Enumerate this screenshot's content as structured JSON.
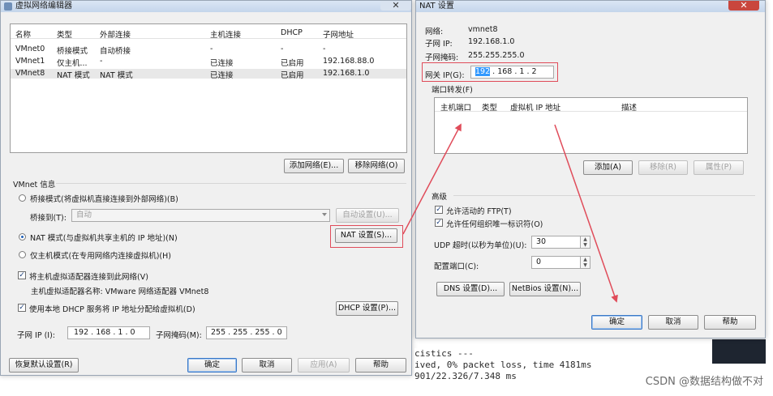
{
  "vne": {
    "title": "虚拟网络编辑器",
    "close": "✕",
    "table": {
      "headers": [
        "名称",
        "类型",
        "外部连接",
        "主机连接",
        "DHCP",
        "子网地址"
      ],
      "rows": [
        [
          "VMnet0",
          "桥接模式",
          "自动桥接",
          "-",
          "-",
          "-"
        ],
        [
          "VMnet1",
          "仅主机...",
          "-",
          "已连接",
          "已启用",
          "192.168.88.0"
        ],
        [
          "VMnet8",
          "NAT 模式",
          "NAT 模式",
          "已连接",
          "已启用",
          "192.168.1.0"
        ]
      ]
    },
    "add_network": "添加网络(E)...",
    "remove_network": "移除网络(O)",
    "vmnet_info": "VMnet 信息",
    "bridge_mode": "桥接模式(将虚拟机直接连接到外部网络)(B)",
    "bridge_to_label": "桥接到(T):",
    "bridge_to_value": "自动",
    "auto_settings": "自动设置(U)...",
    "nat_mode": "NAT 模式(与虚拟机共享主机的 IP 地址)(N)",
    "nat_settings": "NAT 设置(S)...",
    "host_only": "仅主机模式(在专用网络内连接虚拟机)(H)",
    "connect_adapter": "将主机虚拟适配器连接到此网络(V)",
    "adapter_name": "主机虚拟适配器名称: VMware 网络适配器 VMnet8",
    "use_dhcp": "使用本地 DHCP 服务将 IP 地址分配给虚拟机(D)",
    "dhcp_settings": "DHCP 设置(P)...",
    "subnet_ip_label": "子网 IP (I):",
    "subnet_ip": "192 . 168 . 1 . 0",
    "subnet_mask_label": "子网掩码(M):",
    "subnet_mask": "255 . 255 . 255 . 0",
    "restore_defaults": "恢复默认设置(R)",
    "ok": "确定",
    "cancel": "取消",
    "apply": "应用(A)",
    "help": "帮助"
  },
  "nat": {
    "title": "NAT 设置",
    "close": "✕",
    "network_label": "网络:",
    "network_value": "vmnet8",
    "subnet_ip_label": "子网 IP:",
    "subnet_ip_value": "192.168.1.0",
    "subnet_mask_label": "子网掩码:",
    "subnet_mask_value": "255.255.255.0",
    "gateway_label": "网关 IP(G):",
    "gateway_first": "192",
    "gateway_rest": " . 168 .  1  .  2",
    "port_forwarding": "端口转发(F)",
    "pf_headers": [
      "主机端口",
      "类型",
      "虚拟机 IP 地址",
      "描述"
    ],
    "add": "添加(A)",
    "remove": "移除(R)",
    "properties": "属性(P)",
    "advanced": "高级",
    "allow_ftp": "允许活动的 FTP(T)",
    "allow_uid": "允许任何组织唯一标识符(O)",
    "udp_timeout_label": "UDP 超时(以秒为单位)(U):",
    "udp_timeout_value": "30",
    "config_port_label": "配置端口(C):",
    "config_port_value": "0",
    "dns_settings": "DNS 设置(D)...",
    "netbios_settings": "NetBios 设置(N)...",
    "ok": "确定",
    "cancel": "取消",
    "help": "帮助"
  },
  "terminal": {
    "lines": [
      "cistics ---",
      "ived, 0% packet loss, time 4181ms",
      " 901/22.326/7.348 ms"
    ]
  },
  "watermark": "CSDN @数据结构做不对",
  "colors": {
    "annotation_red": "#e04c5a",
    "selection_blue": "#3399ff"
  }
}
